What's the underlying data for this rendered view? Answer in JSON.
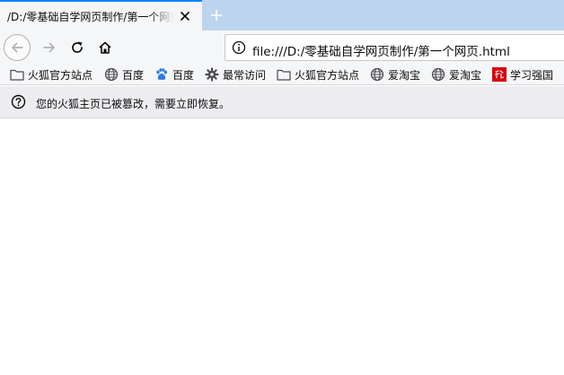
{
  "tab": {
    "title": "/D:/零基础自学网页制作/第一个网页.html"
  },
  "navigation": {
    "url": "file:///D:/零基础自学网页制作/第一个网页.html"
  },
  "bookmarks": [
    {
      "label": "火狐官方站点",
      "icon": "folder-icon"
    },
    {
      "label": "百度",
      "icon": "globe-icon"
    },
    {
      "label": "百度",
      "icon": "baidu-paw-icon"
    },
    {
      "label": "最常访问",
      "icon": "gear-icon"
    },
    {
      "label": "火狐官方站点",
      "icon": "folder-icon"
    },
    {
      "label": "爱淘宝",
      "icon": "globe-icon"
    },
    {
      "label": "爱淘宝",
      "icon": "globe-icon"
    },
    {
      "label": "学习强国",
      "icon": "xuexi-icon"
    }
  ],
  "notification": {
    "message": "您的火狐主页已被篡改，需要立即恢复。"
  },
  "colors": {
    "tab_strip": "#bcd4ee",
    "tab_accent": "#0a84ff",
    "toolbar": "#f5f6f7",
    "notification_bar": "#ededf0",
    "baidu_blue": "#2f7de1",
    "xuexi_red": "#d7000f"
  }
}
